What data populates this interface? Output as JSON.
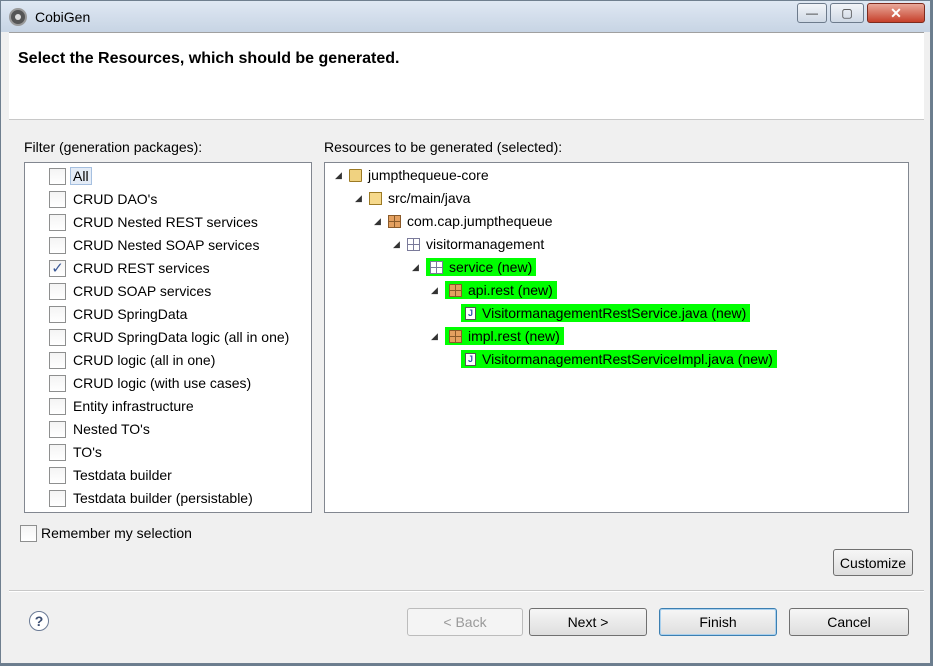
{
  "window": {
    "title": "CobiGen",
    "controls": {
      "minimize": "—",
      "maximize": "▢",
      "close": "✕"
    }
  },
  "header": {
    "title": "Select the Resources, which should be generated."
  },
  "filter": {
    "label": "Filter (generation packages):",
    "items": [
      {
        "label": "All",
        "checked": false
      },
      {
        "label": "CRUD DAO's",
        "checked": false
      },
      {
        "label": "CRUD Nested REST services",
        "checked": false
      },
      {
        "label": "CRUD Nested SOAP services",
        "checked": false
      },
      {
        "label": "CRUD REST services",
        "checked": true
      },
      {
        "label": "CRUD SOAP services",
        "checked": false
      },
      {
        "label": "CRUD SpringData",
        "checked": false
      },
      {
        "label": "CRUD SpringData logic (all in one)",
        "checked": false
      },
      {
        "label": "CRUD logic (all in one)",
        "checked": false
      },
      {
        "label": "CRUD logic (with use cases)",
        "checked": false
      },
      {
        "label": "Entity infrastructure",
        "checked": false
      },
      {
        "label": "Nested TO's",
        "checked": false
      },
      {
        "label": "TO's",
        "checked": false
      },
      {
        "label": "Testdata builder",
        "checked": false
      },
      {
        "label": "Testdata builder (persistable)",
        "checked": false
      }
    ]
  },
  "resources": {
    "label": "Resources to be generated (selected):",
    "tree": [
      {
        "label": "jumpthequeue-core",
        "icon": "project-folder-icon",
        "highlight": false
      },
      {
        "label": "src/main/java",
        "icon": "source-folder-icon",
        "highlight": false
      },
      {
        "label": "com.cap.jumpthequeue",
        "icon": "package-icon",
        "highlight": false
      },
      {
        "label": "visitormanagement",
        "icon": "empty-package-icon",
        "highlight": false
      },
      {
        "label": "service (new)",
        "icon": "empty-package-icon",
        "highlight": true
      },
      {
        "label": "api.rest (new)",
        "icon": "package-icon",
        "highlight": true
      },
      {
        "label": "VisitormanagementRestService.java (new)",
        "icon": "java-file-icon",
        "highlight": true
      },
      {
        "label": "impl.rest (new)",
        "icon": "package-icon",
        "highlight": true
      },
      {
        "label": "VisitormanagementRestServiceImpl.java (new)",
        "icon": "java-file-icon",
        "highlight": true
      }
    ]
  },
  "remember": {
    "label": "Remember my selection",
    "checked": false
  },
  "buttons": {
    "customize": "Customize",
    "back": "< Back",
    "next": "Next >",
    "finish": "Finish",
    "cancel": "Cancel",
    "help": "?"
  },
  "colors": {
    "highlight": "#00ff00",
    "checkmark": "#3b5998"
  }
}
